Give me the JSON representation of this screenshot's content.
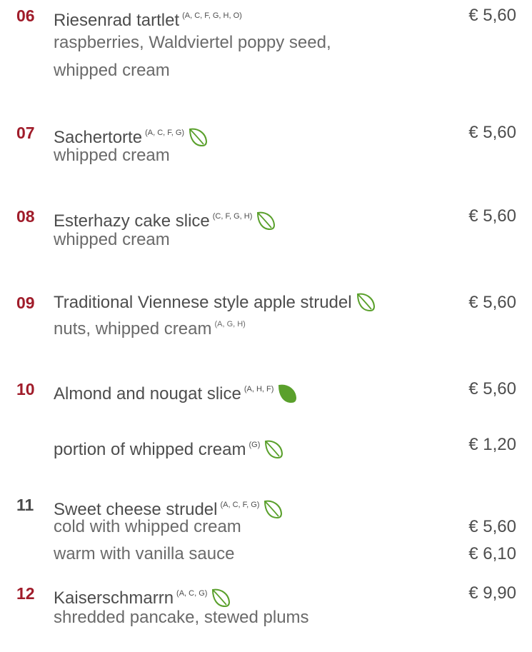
{
  "items": [
    {
      "number": "06",
      "name": "Riesenrad tartlet",
      "allergens": "(A, C, F, G, H, O)",
      "leaf": "none",
      "price": "€ 5,60",
      "lines": [
        "raspberries, Waldviertel poppy seed,",
        "whipped cream"
      ]
    },
    {
      "number": "07",
      "name": "Sachertorte",
      "allergens": "(A, C, F, G)",
      "leaf": "leaf-outline-icon",
      "price": "€ 5,60",
      "lines": [
        "whipped cream"
      ]
    },
    {
      "number": "08",
      "name": "Esterhazy cake slice",
      "allergens": "(C, F, G, H)",
      "leaf": "leaf-outline-icon",
      "price": "€ 5,60",
      "lines": [
        "whipped cream"
      ]
    },
    {
      "number": "09",
      "name": "Traditional Viennese style apple strudel",
      "allergens": "",
      "leaf": "leaf-outline-icon",
      "price": "€ 5,60",
      "lines": [
        "nuts, whipped cream"
      ],
      "line_allergens": "(A, G, H)"
    },
    {
      "number": "10",
      "name": "Almond and nougat slice",
      "allergens": "(A, H, F)",
      "leaf": "leaf-filled-icon",
      "price": "€ 5,60"
    },
    {
      "number": "",
      "name": "portion of whipped cream",
      "allergens": "(G)",
      "leaf": "leaf-outline-icon",
      "price": "€ 1,20"
    },
    {
      "number": "11",
      "name": "Sweet cheese strudel",
      "allergens": "(A, C, F, G)",
      "leaf": "leaf-outline-icon",
      "variants": [
        {
          "label": "cold with whipped cream",
          "price": "€ 5,60"
        },
        {
          "label": "warm with vanilla sauce",
          "price": "€ 6,10"
        }
      ]
    },
    {
      "number": "12",
      "name": "Kaiserschmarrn",
      "allergens": "(A, C, G)",
      "leaf": "leaf-outline-icon",
      "price": "€ 9,90",
      "lines": [
        "shredded pancake, stewed plums"
      ]
    }
  ],
  "colors": {
    "number": "#a01c2a",
    "number_alt": "#4a4a4a",
    "leaf": "#5aa02c",
    "text": "#4d4d4d"
  }
}
